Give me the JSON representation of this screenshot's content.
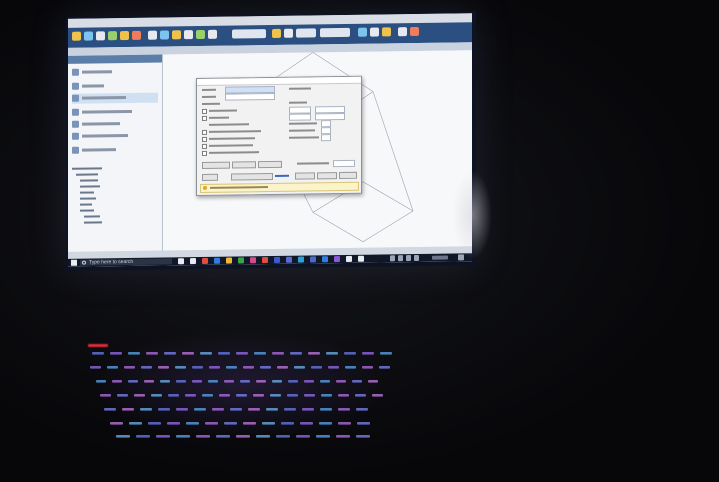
{
  "taskbar": {
    "search_placeholder": "Type here to search"
  },
  "colors": {
    "background": "#0a0a0c",
    "app_ribbon": "#2a4f80",
    "dialog_warning": "#fbf3c9",
    "taskbar": "#101828",
    "keyboard_power_led": "#e2283a"
  },
  "icons": [
    "windows-start-icon",
    "search-icon",
    "taskbar-app-icons",
    "app-toolbar-icons"
  ]
}
